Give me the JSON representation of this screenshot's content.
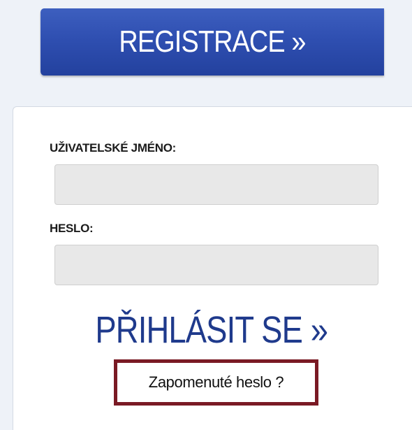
{
  "register": {
    "label": "REGISTRACE »"
  },
  "login_form": {
    "username_label": "UŽIVATELSKÉ JMÉNO:",
    "username_value": "",
    "password_label": "HESLO:",
    "password_value": "",
    "login_label": "PŘIHLÁSIT SE »",
    "forgot_label": "Zapomenuté heslo ?"
  },
  "colors": {
    "register_bg": "#2f4fb1",
    "login_text": "#1f3a8c",
    "highlight_border": "#7a1a24",
    "input_bg": "#e8e8e8"
  }
}
